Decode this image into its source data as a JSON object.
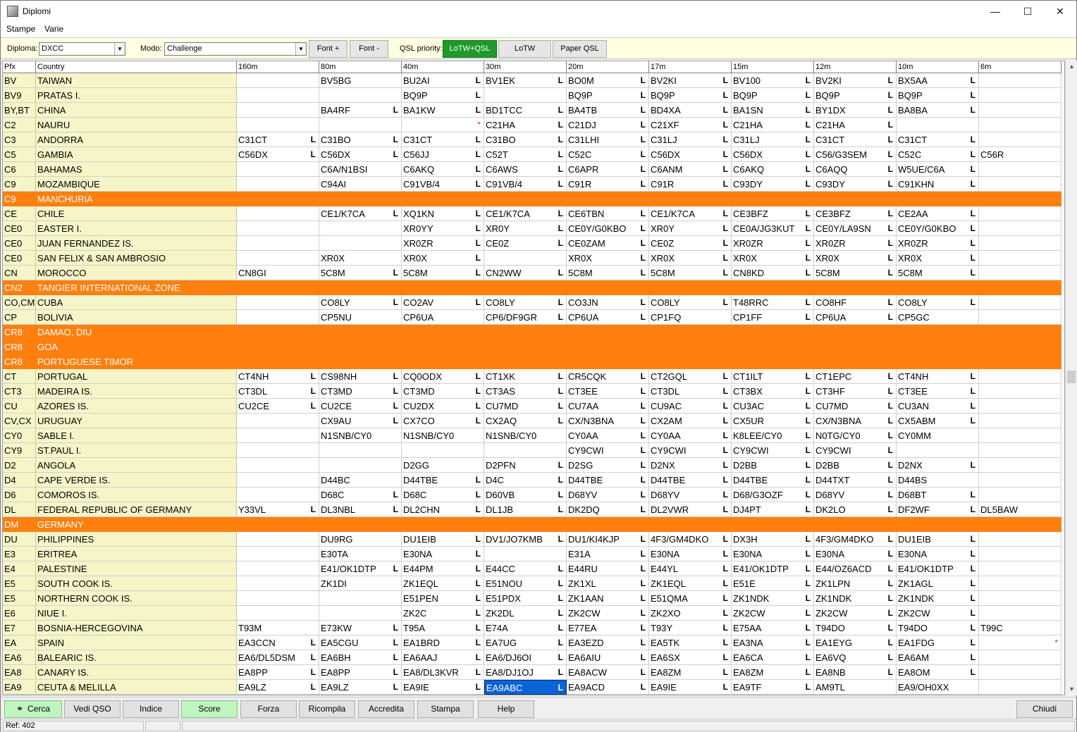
{
  "window": {
    "title": "Diplomi",
    "minimize": "—",
    "maximize": "☐",
    "close": "✕"
  },
  "menu": [
    "Stampe",
    "Varie"
  ],
  "toolbar": {
    "diploma_label": "Diploma:",
    "diploma_value": "DXCC",
    "modo_label": "Modo:",
    "modo_value": "Challenge",
    "font_plus": "Font +",
    "font_minus": "Font -",
    "qsl_priority_label": "QSL priority:",
    "qsl_buttons": [
      "LoTW+QSL",
      "LoTW",
      "Paper QSL"
    ],
    "qsl_active": "LoTW+QSL",
    "active_color": "#1f9a2a"
  },
  "grid": {
    "columns": [
      "Pfx",
      "Country",
      "160m",
      "80m",
      "40m",
      "30m",
      "20m",
      "17m",
      "15m",
      "12m",
      "10m",
      "6m"
    ],
    "highlight_color": "#ff7f0f",
    "selected_color": "#0a64d8",
    "rows": [
      {
        "pfx": "BV",
        "country": "TAIWAN",
        "bands": [
          "",
          "BV5BG",
          "BU2AI|L",
          "BV1EK|L",
          "BO0M|L",
          "BV2KI|L",
          "BV100|L",
          "BV2KI|L",
          "BX5AA|L",
          ""
        ]
      },
      {
        "pfx": "BV9",
        "country": "PRATAS I.",
        "bands": [
          "",
          "",
          "BQ9P|L",
          "",
          "BQ9P|L",
          "BQ9P|L",
          "BQ9P|L",
          "BQ9P|L",
          "BQ9P|L",
          ""
        ]
      },
      {
        "pfx": "BY,BT",
        "country": "CHINA",
        "bands": [
          "",
          "BA4RF|L",
          "BA1KW|L",
          "BD1TCC|L",
          "BA4TB|L",
          "BD4XA|L",
          "BA1SN|L",
          "BY1DX|L",
          "BA8BA|L",
          ""
        ]
      },
      {
        "pfx": "C2",
        "country": "NAURU",
        "bands": [
          "",
          "",
          "|*",
          "C21HA|L",
          "C21DJ|L",
          "C21XF|L",
          "C21HA|L",
          "C21HA|L",
          "",
          ""
        ]
      },
      {
        "pfx": "C3",
        "country": "ANDORRA",
        "bands": [
          "C31CT|L",
          "C31BO|L",
          "C31CT|L",
          "C31BO|L",
          "C31LHI|L",
          "C31LJ|L",
          "C31LJ|L",
          "C31CT|L",
          "C31CT|L",
          ""
        ]
      },
      {
        "pfx": "C5",
        "country": "GAMBIA",
        "bands": [
          "C56DX|L",
          "C56DX|L",
          "C56JJ|L",
          "C52T|L",
          "C52C|L",
          "C56DX|L",
          "C56DX|L",
          "C56/G3SEM|L",
          "C52C|L",
          "C56R"
        ]
      },
      {
        "pfx": "C6",
        "country": "BAHAMAS",
        "bands": [
          "",
          "C6A/N1BSI",
          "C6AKQ|L",
          "C6AWS|L",
          "C6APR|L",
          "C6ANM|L",
          "C6AKQ|L",
          "C6AQQ|L",
          "W5UE/C6A|L",
          ""
        ]
      },
      {
        "pfx": "C9",
        "country": "MOZAMBIQUE",
        "bands": [
          "",
          "C94AI",
          "C91VB/4|L",
          "C91VB/4|L",
          "C91R|L",
          "C91R|L",
          "C93DY|L",
          "C93DY|L",
          "C91KHN|L",
          ""
        ]
      },
      {
        "pfx": "C9",
        "country": "MANCHURIA",
        "deleted": true,
        "bands": [
          "",
          "",
          "",
          "",
          "",
          "",
          "",
          "",
          "",
          ""
        ]
      },
      {
        "pfx": "CE",
        "country": "CHILE",
        "bands": [
          "",
          "CE1/K7CA|L",
          "XQ1KN|L",
          "CE1/K7CA|L",
          "CE6TBN|L",
          "CE1/K7CA|L",
          "CE3BFZ|L",
          "CE3BFZ|L",
          "CE2AA|L",
          ""
        ]
      },
      {
        "pfx": "CE0",
        "country": "EASTER I.",
        "bands": [
          "",
          "",
          "XR0YY|L",
          "XR0Y|L",
          "CE0Y/G0KBO|L",
          "XR0Y|L",
          "CE0A/JG3KUT|L",
          "CE0Y/LA9SN|L",
          "CE0Y/G0KBO|L",
          ""
        ]
      },
      {
        "pfx": "CE0",
        "country": "JUAN FERNANDEZ IS.",
        "bands": [
          "",
          "",
          "XR0ZR|L",
          "CE0Z|L",
          "CE0ZAM|L",
          "CE0Z|L",
          "XR0ZR|L",
          "XR0ZR|L",
          "XR0ZR|L",
          ""
        ]
      },
      {
        "pfx": "CE0",
        "country": "SAN FELIX & SAN AMBROSIO",
        "bands": [
          "",
          "XR0X",
          "XR0X|L",
          "",
          "XR0X|L",
          "XR0X|L",
          "XR0X|L",
          "XR0X|L",
          "XR0X|L",
          ""
        ]
      },
      {
        "pfx": "CN",
        "country": "MOROCCO",
        "bands": [
          "CN8GI",
          "5C8M|L",
          "5C8M|L",
          "CN2WW|L",
          "5C8M|L",
          "5C8M|L",
          "CN8KD|L",
          "5C8M|L",
          "5C8M|L",
          ""
        ]
      },
      {
        "pfx": "CN2",
        "country": "TANGIER INTERNATIONAL ZONE",
        "deleted": true,
        "bands": [
          "",
          "",
          "",
          "",
          "",
          "",
          "",
          "",
          "",
          ""
        ]
      },
      {
        "pfx": "CO,CM",
        "country": "CUBA",
        "bands": [
          "",
          "CO8LY|L",
          "CO2AV|L",
          "CO8LY|L",
          "CO3JN|L",
          "CO8LY|L",
          "T48RRC|L",
          "CO8HF|L",
          "CO8LY|L",
          ""
        ]
      },
      {
        "pfx": "CP",
        "country": "BOLIVIA",
        "bands": [
          "",
          "CP5NU",
          "CP6UA",
          "CP6/DF9GR|L",
          "CP6UA|L",
          "CP1FQ",
          "CP1FF|L",
          "CP6UA|L",
          "CP5GC",
          ""
        ]
      },
      {
        "pfx": "CR8",
        "country": "DAMAO, DIU",
        "deleted": true,
        "bands": [
          "",
          "",
          "",
          "",
          "",
          "",
          "",
          "",
          "",
          ""
        ]
      },
      {
        "pfx": "CR8",
        "country": "GOA",
        "deleted": true,
        "bands": [
          "",
          "",
          "",
          "",
          "",
          "",
          "",
          "",
          "",
          ""
        ]
      },
      {
        "pfx": "CR8",
        "country": "PORTUGUESE TIMOR",
        "deleted": true,
        "bands": [
          "",
          "",
          "",
          "",
          "",
          "",
          "",
          "",
          "",
          ""
        ]
      },
      {
        "pfx": "CT",
        "country": "PORTUGAL",
        "bands": [
          "CT4NH|L",
          "CS98NH|L",
          "CQ0ODX|L",
          "CT1XK|L",
          "CR5CQK|L",
          "CT2GQL|L",
          "CT1ILT|L",
          "CT1EPC|L",
          "CT4NH|L",
          ""
        ]
      },
      {
        "pfx": "CT3",
        "country": "MADEIRA IS.",
        "bands": [
          "CT3DL|L",
          "CT3MD|L",
          "CT3MD|L",
          "CT3AS|L",
          "CT3EE|L",
          "CT3DL|L",
          "CT3BX|L",
          "CT3HF|L",
          "CT3EE|L",
          ""
        ]
      },
      {
        "pfx": "CU",
        "country": "AZORES IS.",
        "bands": [
          "CU2CE|L",
          "CU2CE|L",
          "CU2DX|L",
          "CU7MD|L",
          "CU7AA|L",
          "CU9AC|L",
          "CU3AC|L",
          "CU7MD|L",
          "CU3AN|L",
          ""
        ]
      },
      {
        "pfx": "CV,CX",
        "country": "URUGUAY",
        "bands": [
          "",
          "CX9AU|L",
          "CX7CO|L",
          "CX2AQ|L",
          "CX/N3BNA|L",
          "CX2AM|L",
          "CX5UR|L",
          "CX/N3BNA|L",
          "CX5ABM|L",
          ""
        ]
      },
      {
        "pfx": "CY0",
        "country": "SABLE I.",
        "bands": [
          "",
          "N1SNB/CY0",
          "N1SNB/CY0",
          "N1SNB/CY0",
          "CY0AA|L",
          "CY0AA|L",
          "K8LEE/CY0|L",
          "N0TG/CY0|L",
          "CY0MM",
          ""
        ]
      },
      {
        "pfx": "CY9",
        "country": "ST.PAUL I.",
        "bands": [
          "",
          "",
          "",
          "",
          "CY9CWI|L",
          "CY9CWI|L",
          "CY9CWI|L",
          "CY9CWI|L",
          "",
          ""
        ]
      },
      {
        "pfx": "D2",
        "country": "ANGOLA",
        "bands": [
          "",
          "",
          "D2GG",
          "D2PFN|L",
          "D2SG|L",
          "D2NX|L",
          "D2BB|L",
          "D2BB|L",
          "D2NX|L",
          ""
        ]
      },
      {
        "pfx": "D4",
        "country": "CAPE VERDE IS.",
        "bands": [
          "",
          "D44BC",
          "D44TBE|L",
          "D4C|L",
          "D44TBE|L",
          "D44TBE|L",
          "D44TBE|L",
          "D44TXT|L",
          "D44BS",
          ""
        ]
      },
      {
        "pfx": "D6",
        "country": "COMOROS IS.",
        "bands": [
          "",
          "D68C|L",
          "D68C|L",
          "D60VB|L",
          "D68YV|L",
          "D68YV|L",
          "D68/G3OZF|L",
          "D68YV|L",
          "D68BT|L",
          ""
        ]
      },
      {
        "pfx": "DL",
        "country": "FEDERAL REPUBLIC OF GERMANY",
        "bands": [
          "Y33VL|L",
          "DL3NBL|L",
          "DL2CHN|L",
          "DL1JB|L",
          "DK2DQ|L",
          "DL2VWR|L",
          "DJ4PT|L",
          "DK2LO|L",
          "DF2WF|L",
          "DL5BAW"
        ]
      },
      {
        "pfx": "DM",
        "country": "GERMANY",
        "deleted": true,
        "bands": [
          "",
          "",
          "",
          "",
          "",
          "",
          "",
          "",
          "",
          ""
        ]
      },
      {
        "pfx": "DU",
        "country": "PHILIPPINES",
        "bands": [
          "",
          "DU9RG",
          "DU1EIB|L",
          "DV1/JO7KMB|L",
          "DU1/KI4KJP|L",
          "4F3/GM4DKO|L",
          "DX3H|L",
          "4F3/GM4DKO|L",
          "DU1EIB|L",
          ""
        ]
      },
      {
        "pfx": "E3",
        "country": "ERITREA",
        "bands": [
          "",
          "E30TA",
          "E30NA|L",
          "",
          "E31A|L",
          "E30NA|L",
          "E30NA|L",
          "E30NA|L",
          "E30NA|L",
          ""
        ]
      },
      {
        "pfx": "E4",
        "country": "PALESTINE",
        "bands": [
          "",
          "E41/OK1DTP|L",
          "E44PM|L",
          "E44CC|L",
          "E44RU|L",
          "E44YL|L",
          "E41/OK1DTP|L",
          "E44/OZ6ACD|L",
          "E41/OK1DTP|L",
          ""
        ]
      },
      {
        "pfx": "E5",
        "country": "SOUTH COOK IS.",
        "bands": [
          "",
          "ZK1DI",
          "ZK1EQL|L",
          "E51NOU|L",
          "ZK1XL|L",
          "ZK1EQL|L",
          "E51E|L",
          "ZK1LPN|L",
          "ZK1AGL|L",
          ""
        ]
      },
      {
        "pfx": "E5",
        "country": "NORTHERN COOK IS.",
        "bands": [
          "",
          "",
          "E51PEN|L",
          "E51PDX|L",
          "ZK1AAN|L",
          "E51QMA|L",
          "ZK1NDK|L",
          "ZK1NDK|L",
          "ZK1NDK|L",
          ""
        ]
      },
      {
        "pfx": "E6",
        "country": "NIUE I.",
        "bands": [
          "",
          "",
          "ZK2C|L",
          "ZK2DL|L",
          "ZK2CW|L",
          "ZK2XO|L",
          "ZK2CW|L",
          "ZK2CW|L",
          "ZK2CW|L",
          ""
        ]
      },
      {
        "pfx": "E7",
        "country": "BOSNIA-HERCEGOVINA",
        "bands": [
          "T93M",
          "E73KW|L",
          "T95A|L",
          "E74A|L",
          "E77EA|L",
          "T93Y|L",
          "E75AA|L",
          "T94DO|L",
          "T94DO|L",
          "T99C"
        ]
      },
      {
        "pfx": "EA",
        "country": "SPAIN",
        "bands": [
          "EA3CCN|L",
          "EA5CGU|L",
          "EA1BRD|L",
          "EA7UG|L",
          "EA3EZD|L",
          "EA5TK|L",
          "EA3NA|L",
          "EA1EYG|L",
          "EA1FDG|L",
          "|*"
        ]
      },
      {
        "pfx": "EA6",
        "country": "BALEARIC IS.",
        "bands": [
          "EA6/DL5DSM|L",
          "EA6BH|L",
          "EA6AAJ|L",
          "EA6/DJ6OI|L",
          "EA6AIU|L",
          "EA6SX|L",
          "EA6CA|L",
          "EA6VQ|L",
          "EA6AM|L",
          ""
        ]
      },
      {
        "pfx": "EA8",
        "country": "CANARY IS.",
        "bands": [
          "EA8PP|L",
          "EA8PP|L",
          "EA8/DL3KVR|L",
          "EA8/DJ1OJ|L",
          "EA8ACW|L",
          "EA8ZM|L",
          "EA8ZM|L",
          "EA8NB|L",
          "EA8OM|L",
          ""
        ]
      },
      {
        "pfx": "EA9",
        "country": "CEUTA & MELILLA",
        "bands": [
          "EA9LZ|L",
          "EA9LZ|L",
          "EA9IE|L",
          "EA9ABC|L|sel",
          "EA9ACD|L",
          "EA9IE|L",
          "EA9TF|L",
          "AM9TL",
          "EA9/OH0XX",
          ""
        ]
      }
    ]
  },
  "bottom_buttons": [
    {
      "label": "Cerca",
      "icon": "binoculars-icon",
      "green": true
    },
    {
      "label": "Vedi QSO"
    },
    {
      "label": "Indice"
    },
    {
      "label": "Score",
      "green": true
    },
    {
      "label": "Forza"
    },
    {
      "label": "Ricompila"
    },
    {
      "label": "Accredita"
    },
    {
      "label": "Stampa"
    },
    {
      "label": "Help"
    },
    {
      "label": "Chiudi"
    }
  ],
  "status": {
    "ref": "Ref: 402"
  }
}
